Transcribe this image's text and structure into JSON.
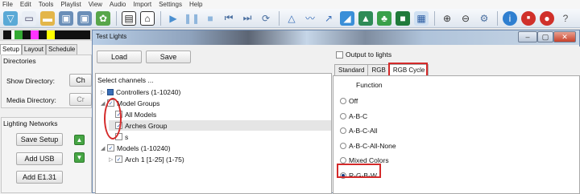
{
  "menubar": [
    "File",
    "Edit",
    "Tools",
    "Playlist",
    "View",
    "Audio",
    "Import",
    "Settings",
    "Help"
  ],
  "main": {
    "tabs": [
      "Setup",
      "Layout",
      "Schedule"
    ],
    "directories_label": "Directories",
    "show_dir_label": "Show Directory:",
    "show_dir_button": "Ch",
    "media_dir_label": "Media Directory:",
    "media_dir_button": "Cr",
    "lighting_networks_label": "Lighting Networks",
    "save_setup": "Save Setup",
    "add_usb": "Add USB",
    "add_e131": "Add E1.31"
  },
  "dialog": {
    "title": "Test Lights",
    "window_controls": [
      "–",
      "▢",
      "✕"
    ],
    "load_label": "Load",
    "save_label": "Save",
    "output_to_lights": "Output to lights",
    "select_channels": "Select channels ...",
    "tree": [
      {
        "label": "Controllers (1-10240)",
        "indent": 0,
        "expander": "▷",
        "kind": "controllers"
      },
      {
        "label": "Model Groups",
        "indent": 0,
        "expander": "◢",
        "kind": "checkbox",
        "checked": true
      },
      {
        "label": "All Models",
        "indent": 1,
        "expander": "",
        "kind": "checkbox",
        "checked": true
      },
      {
        "label": "Arches Group",
        "indent": 1,
        "expander": "",
        "kind": "checkbox",
        "checked": true,
        "selected": true
      },
      {
        "label": "s",
        "indent": 1,
        "expander": "",
        "kind": "checkbox",
        "checked": false
      },
      {
        "label": "Models (1-10240)",
        "indent": 0,
        "expander": "◢",
        "kind": "checkbox",
        "checked": true
      },
      {
        "label": "Arch 1 [1-25] (1-75)",
        "indent": 1,
        "expander": "▷",
        "kind": "checkbox",
        "checked": true
      }
    ],
    "tabs": [
      "Standard",
      "RGB",
      "RGB Cycle"
    ],
    "active_tab": "RGB Cycle",
    "function_label": "Function",
    "functions": [
      "Off",
      "A-B-C",
      "A-B-C-All",
      "A-B-C-All-None",
      "Mixed Colors",
      "R-G-B-W"
    ],
    "selected_function": "R-G-B-W"
  },
  "colors": {
    "highlight_red": "#d42a2a",
    "green_button": "#46a544",
    "checkbox_check": "#2b5cad"
  }
}
